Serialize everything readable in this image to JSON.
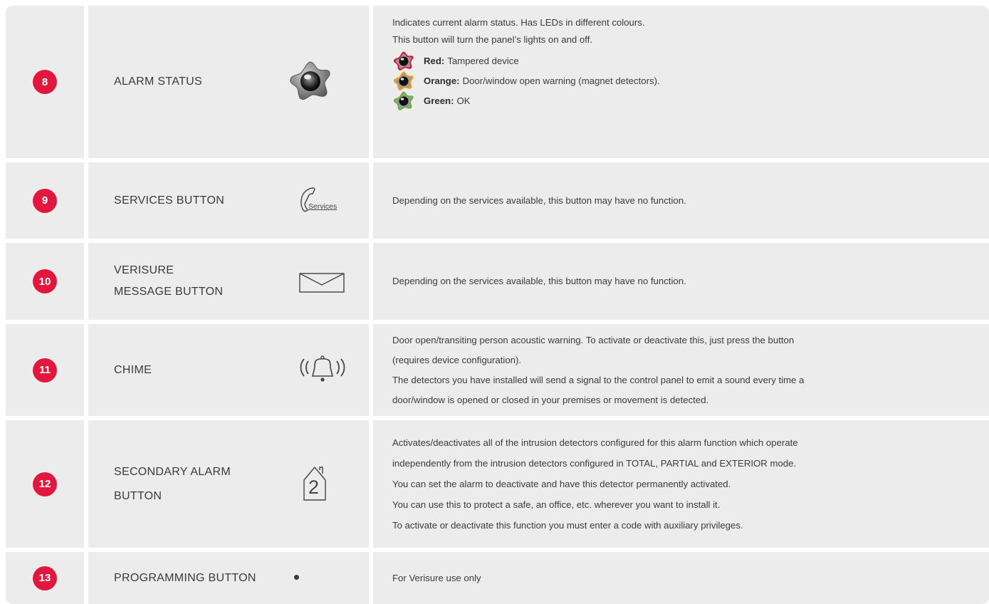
{
  "rows": [
    {
      "number": "8",
      "name": "ALARM STATUS",
      "icon": "alarm-status-star-icon",
      "description_lines": [
        "Indicates current alarm status. Has LEDs in different colours.",
        "This button will turn the panel’s lights on and off."
      ],
      "leds": [
        {
          "color_name": "Red:",
          "meaning": "Tampered device",
          "color": "#e3173e"
        },
        {
          "color_name": "Orange:",
          "meaning": "Door/window open warning (magnet detectors).",
          "color": "#f39a1e"
        },
        {
          "color_name": "Green:",
          "meaning": "OK",
          "color": "#6cb33f"
        }
      ]
    },
    {
      "number": "9",
      "name": "SERVICES BUTTON",
      "icon": "services-phone-icon",
      "icon_label": "Services",
      "description_lines": [
        "Depending on the services available, this button may have no function."
      ]
    },
    {
      "number": "10",
      "name_lines": [
        "VERISURE",
        "MESSAGE BUTTON"
      ],
      "icon": "envelope-icon",
      "description_lines": [
        "Depending on the services available, this button may have no function."
      ]
    },
    {
      "number": "11",
      "name": "CHIME",
      "icon": "bell-chime-icon",
      "description_lines": [
        "Door open/transiting person acoustic warning. To activate or deactivate this, just press the button",
        "(requires device configuration).",
        "The detectors you have installed will send a signal to the control panel to emit a sound every time a",
        "door/window is opened or closed in your premises or movement is detected."
      ]
    },
    {
      "number": "12",
      "name_lines": [
        "SECONDARY ALARM",
        "BUTTON"
      ],
      "icon": "house-2-icon",
      "icon_label": "2",
      "description_lines": [
        "Activates/deactivates all of the intrusion detectors configured for this alarm function which operate",
        "independently from the intrusion detectors configured in TOTAL, PARTIAL and EXTERIOR mode.",
        "You can set the alarm to deactivate and have this detector permanently activated.",
        "You can use this to protect a safe, an office, etc. wherever you want to install it.",
        "To activate or deactivate this function you must enter a code with auxiliary privileges."
      ]
    },
    {
      "number": "13",
      "name": "PROGRAMMING BUTTON",
      "icon": "dot-icon",
      "description_lines": [
        "For Verisure use only"
      ]
    }
  ],
  "colors": {
    "accent": "#e3173e",
    "cell_bg": "#ececec"
  }
}
